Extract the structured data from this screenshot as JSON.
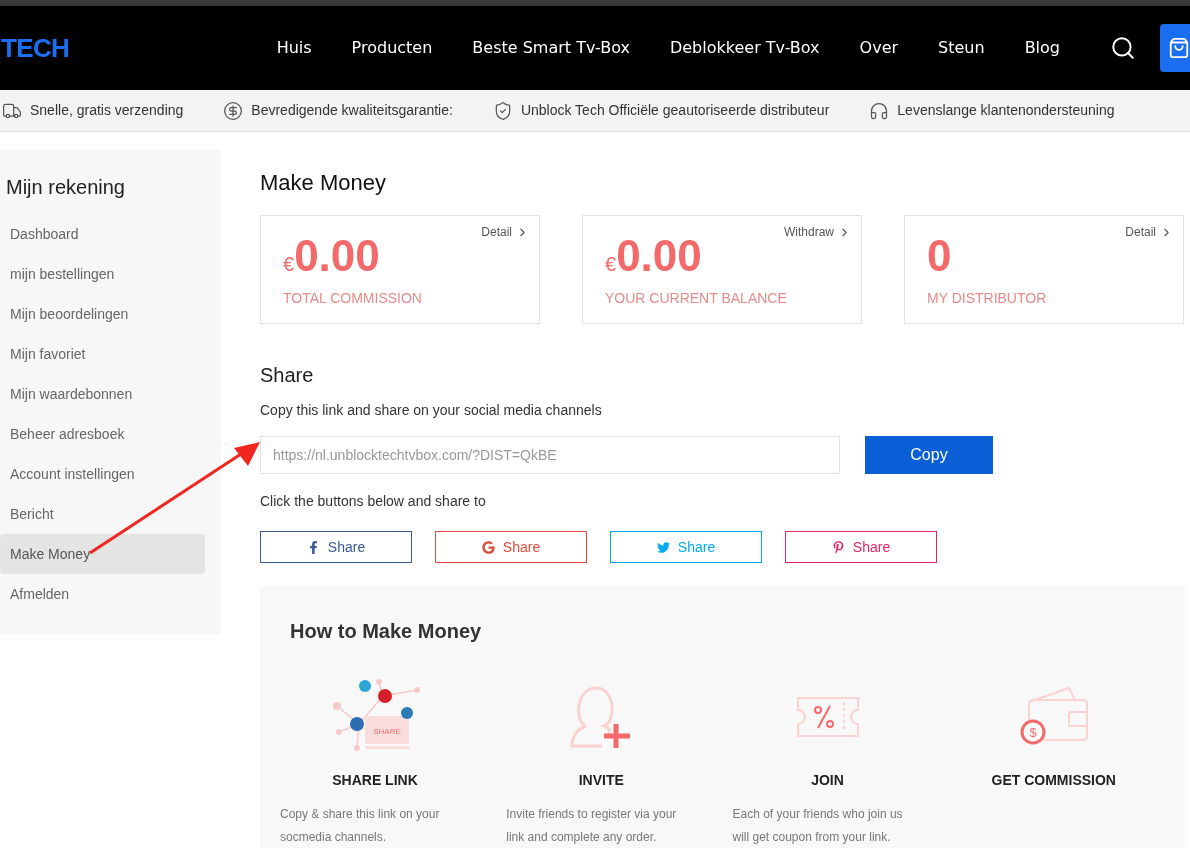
{
  "header": {
    "logo": "TECH",
    "nav": [
      {
        "label": "Huis"
      },
      {
        "label": "Producten"
      },
      {
        "label": "Beste Smart Tv-Box"
      },
      {
        "label": "Deblokkeer Tv-Box"
      },
      {
        "label": "Over"
      },
      {
        "label": "Steun"
      },
      {
        "label": "Blog"
      }
    ]
  },
  "benefits": [
    {
      "kind": "truck",
      "text": "Snelle, gratis verzending"
    },
    {
      "kind": "money",
      "text": "Bevredigende kwaliteitsgarantie:"
    },
    {
      "kind": "shield",
      "text": "Unblock Tech Officiële geautoriseerde distributeur"
    },
    {
      "kind": "headset",
      "text": "Levenslange klantenondersteuning"
    }
  ],
  "sidebar": {
    "title": "Mijn rekening",
    "items": [
      {
        "label": "Dashboard",
        "selected": false
      },
      {
        "label": "mijn bestellingen",
        "selected": false
      },
      {
        "label": "Mijn beoordelingen",
        "selected": false
      },
      {
        "label": "Mijn favoriet",
        "selected": false
      },
      {
        "label": "Mijn waardebonnen",
        "selected": false
      },
      {
        "label": "Beheer adresboek",
        "selected": false
      },
      {
        "label": "Account instellingen",
        "selected": false
      },
      {
        "label": "Bericht",
        "selected": false
      },
      {
        "label": "Make Money",
        "selected": true
      },
      {
        "label": "Afmelden",
        "selected": false
      }
    ]
  },
  "page_title": "Make Money",
  "stats": [
    {
      "link": "Detail",
      "currency": "€",
      "value": "0.00",
      "label": "TOTAL COMMISSION"
    },
    {
      "link": "Withdraw",
      "currency": "€",
      "value": "0.00",
      "label": "YOUR CURRENT BALANCE"
    },
    {
      "link": "Detail",
      "value": "0",
      "label": "MY DISTRIBUTOR"
    }
  ],
  "share": {
    "title": "Share",
    "instruction": "Copy this link and share on your social media channels",
    "link": "https://nl.unblocktechtvbox.com/?DIST=QkBE",
    "copy_button": "Copy",
    "buttons_hint": "Click the buttons below and share to",
    "buttons": [
      {
        "kind": "facebook",
        "label": "Share",
        "color": "#3b5998"
      },
      {
        "kind": "google",
        "label": "Share",
        "color": "#dd4b39"
      },
      {
        "kind": "twitter",
        "label": "Share",
        "color": "#00acee"
      },
      {
        "kind": "pinterest",
        "label": "Share",
        "color": "#e4245e"
      }
    ]
  },
  "how_to": {
    "title": "How to Make Money",
    "steps": [
      {
        "kind": "share",
        "icon_text": "SHARE",
        "title": "SHARE LINK",
        "text": "Copy & share this link on your socmedia channels."
      },
      {
        "kind": "invite",
        "title": "INVITE",
        "text": "Invite friends to register via your link and complete any order."
      },
      {
        "kind": "join",
        "title": "JOIN",
        "text": "Each of your friends who join us will get coupon from your link."
      },
      {
        "kind": "commission",
        "icon_text": "$",
        "title": "GET COMMISSION"
      }
    ]
  }
}
